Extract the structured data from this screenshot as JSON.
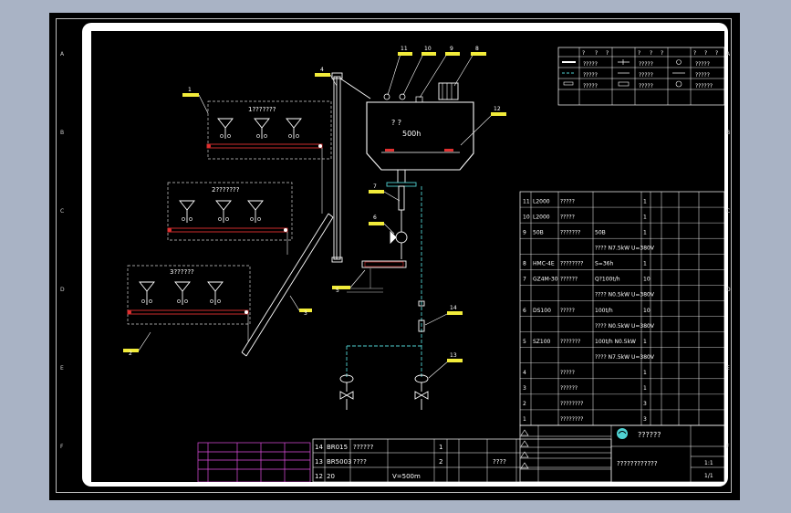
{
  "groups": [
    {
      "label": "1???????"
    },
    {
      "label": "2???????"
    },
    {
      "label": "3??????"
    }
  ],
  "balloons": [
    "1",
    "2",
    "3",
    "4",
    "5",
    "6",
    "7",
    "8",
    "9",
    "10",
    "11",
    "12",
    "13",
    "14"
  ],
  "tank": {
    "text1": "? ?",
    "text2": "500h"
  },
  "frame_zones": {
    "left": [
      "A",
      "B",
      "C",
      "D",
      "E",
      "F"
    ],
    "right": [
      "A",
      "B",
      "C",
      "D",
      "E",
      "F"
    ]
  },
  "legend": {
    "header": [
      "?",
      "?",
      "?",
      "?",
      "?",
      "?",
      "?",
      "?",
      "?"
    ],
    "rows": [
      [
        "?????",
        "?????",
        "?????"
      ],
      [
        "?????",
        "?????",
        "?????"
      ],
      [
        "?????",
        "?????",
        "??????"
      ]
    ]
  },
  "bom_upper": [
    {
      "no": "11",
      "code": "L2000",
      "name": "?????",
      "spec": "",
      "qty": "1"
    },
    {
      "no": "10",
      "code": "L2000",
      "name": "?????",
      "spec": "",
      "qty": "1"
    },
    {
      "no": "9",
      "code": "50B",
      "name": "???????",
      "spec": "50B",
      "qty": "1"
    },
    {
      "no": "",
      "code": "",
      "name": "",
      "spec": "???? N7.5kW U=380V",
      "qty": ""
    },
    {
      "no": "8",
      "code": "HMC-4E",
      "name": "????????",
      "spec": "S=36h",
      "qty": "1"
    },
    {
      "no": "7",
      "code": "GZ4M-30",
      "name": "??????",
      "spec": "Q?100t/h",
      "qty": "10"
    },
    {
      "no": "",
      "code": "",
      "name": "",
      "spec": "???? N0.5kW U=380V",
      "qty": ""
    },
    {
      "no": "6",
      "code": "DS100",
      "name": "?????",
      "spec": "100t/h",
      "qty": "10"
    },
    {
      "no": "",
      "code": "",
      "name": "",
      "spec": "???? N0.5kW U=380V",
      "qty": ""
    },
    {
      "no": "5",
      "code": "SZ100",
      "name": "???????",
      "spec": "100t/h N0.5kW",
      "qty": "1"
    },
    {
      "no": "",
      "code": "",
      "name": "",
      "spec": "???? N7.5kW U=380V",
      "qty": ""
    },
    {
      "no": "4",
      "code": "",
      "name": "?????",
      "spec": "",
      "qty": "1"
    },
    {
      "no": "3",
      "code": "",
      "name": "??????",
      "spec": "",
      "qty": "1"
    },
    {
      "no": "2",
      "code": "",
      "name": "????????",
      "spec": "",
      "qty": "3"
    },
    {
      "no": "1",
      "code": "",
      "name": "????????",
      "spec": "",
      "qty": "3"
    }
  ],
  "bom_lower": [
    {
      "no": "14",
      "code": "BR015",
      "name": "??????",
      "qty": "1"
    },
    {
      "no": "13",
      "code": "BR5003",
      "name": "????",
      "qty": "2",
      "note": "????"
    },
    {
      "no": "12",
      "code": "20",
      "name": "",
      "spec": "V=500m",
      "qty": ""
    }
  ],
  "title_block": {
    "company": "??????",
    "drawing_title": "????????????",
    "scale": "1:1",
    "sheet": "1/1"
  }
}
